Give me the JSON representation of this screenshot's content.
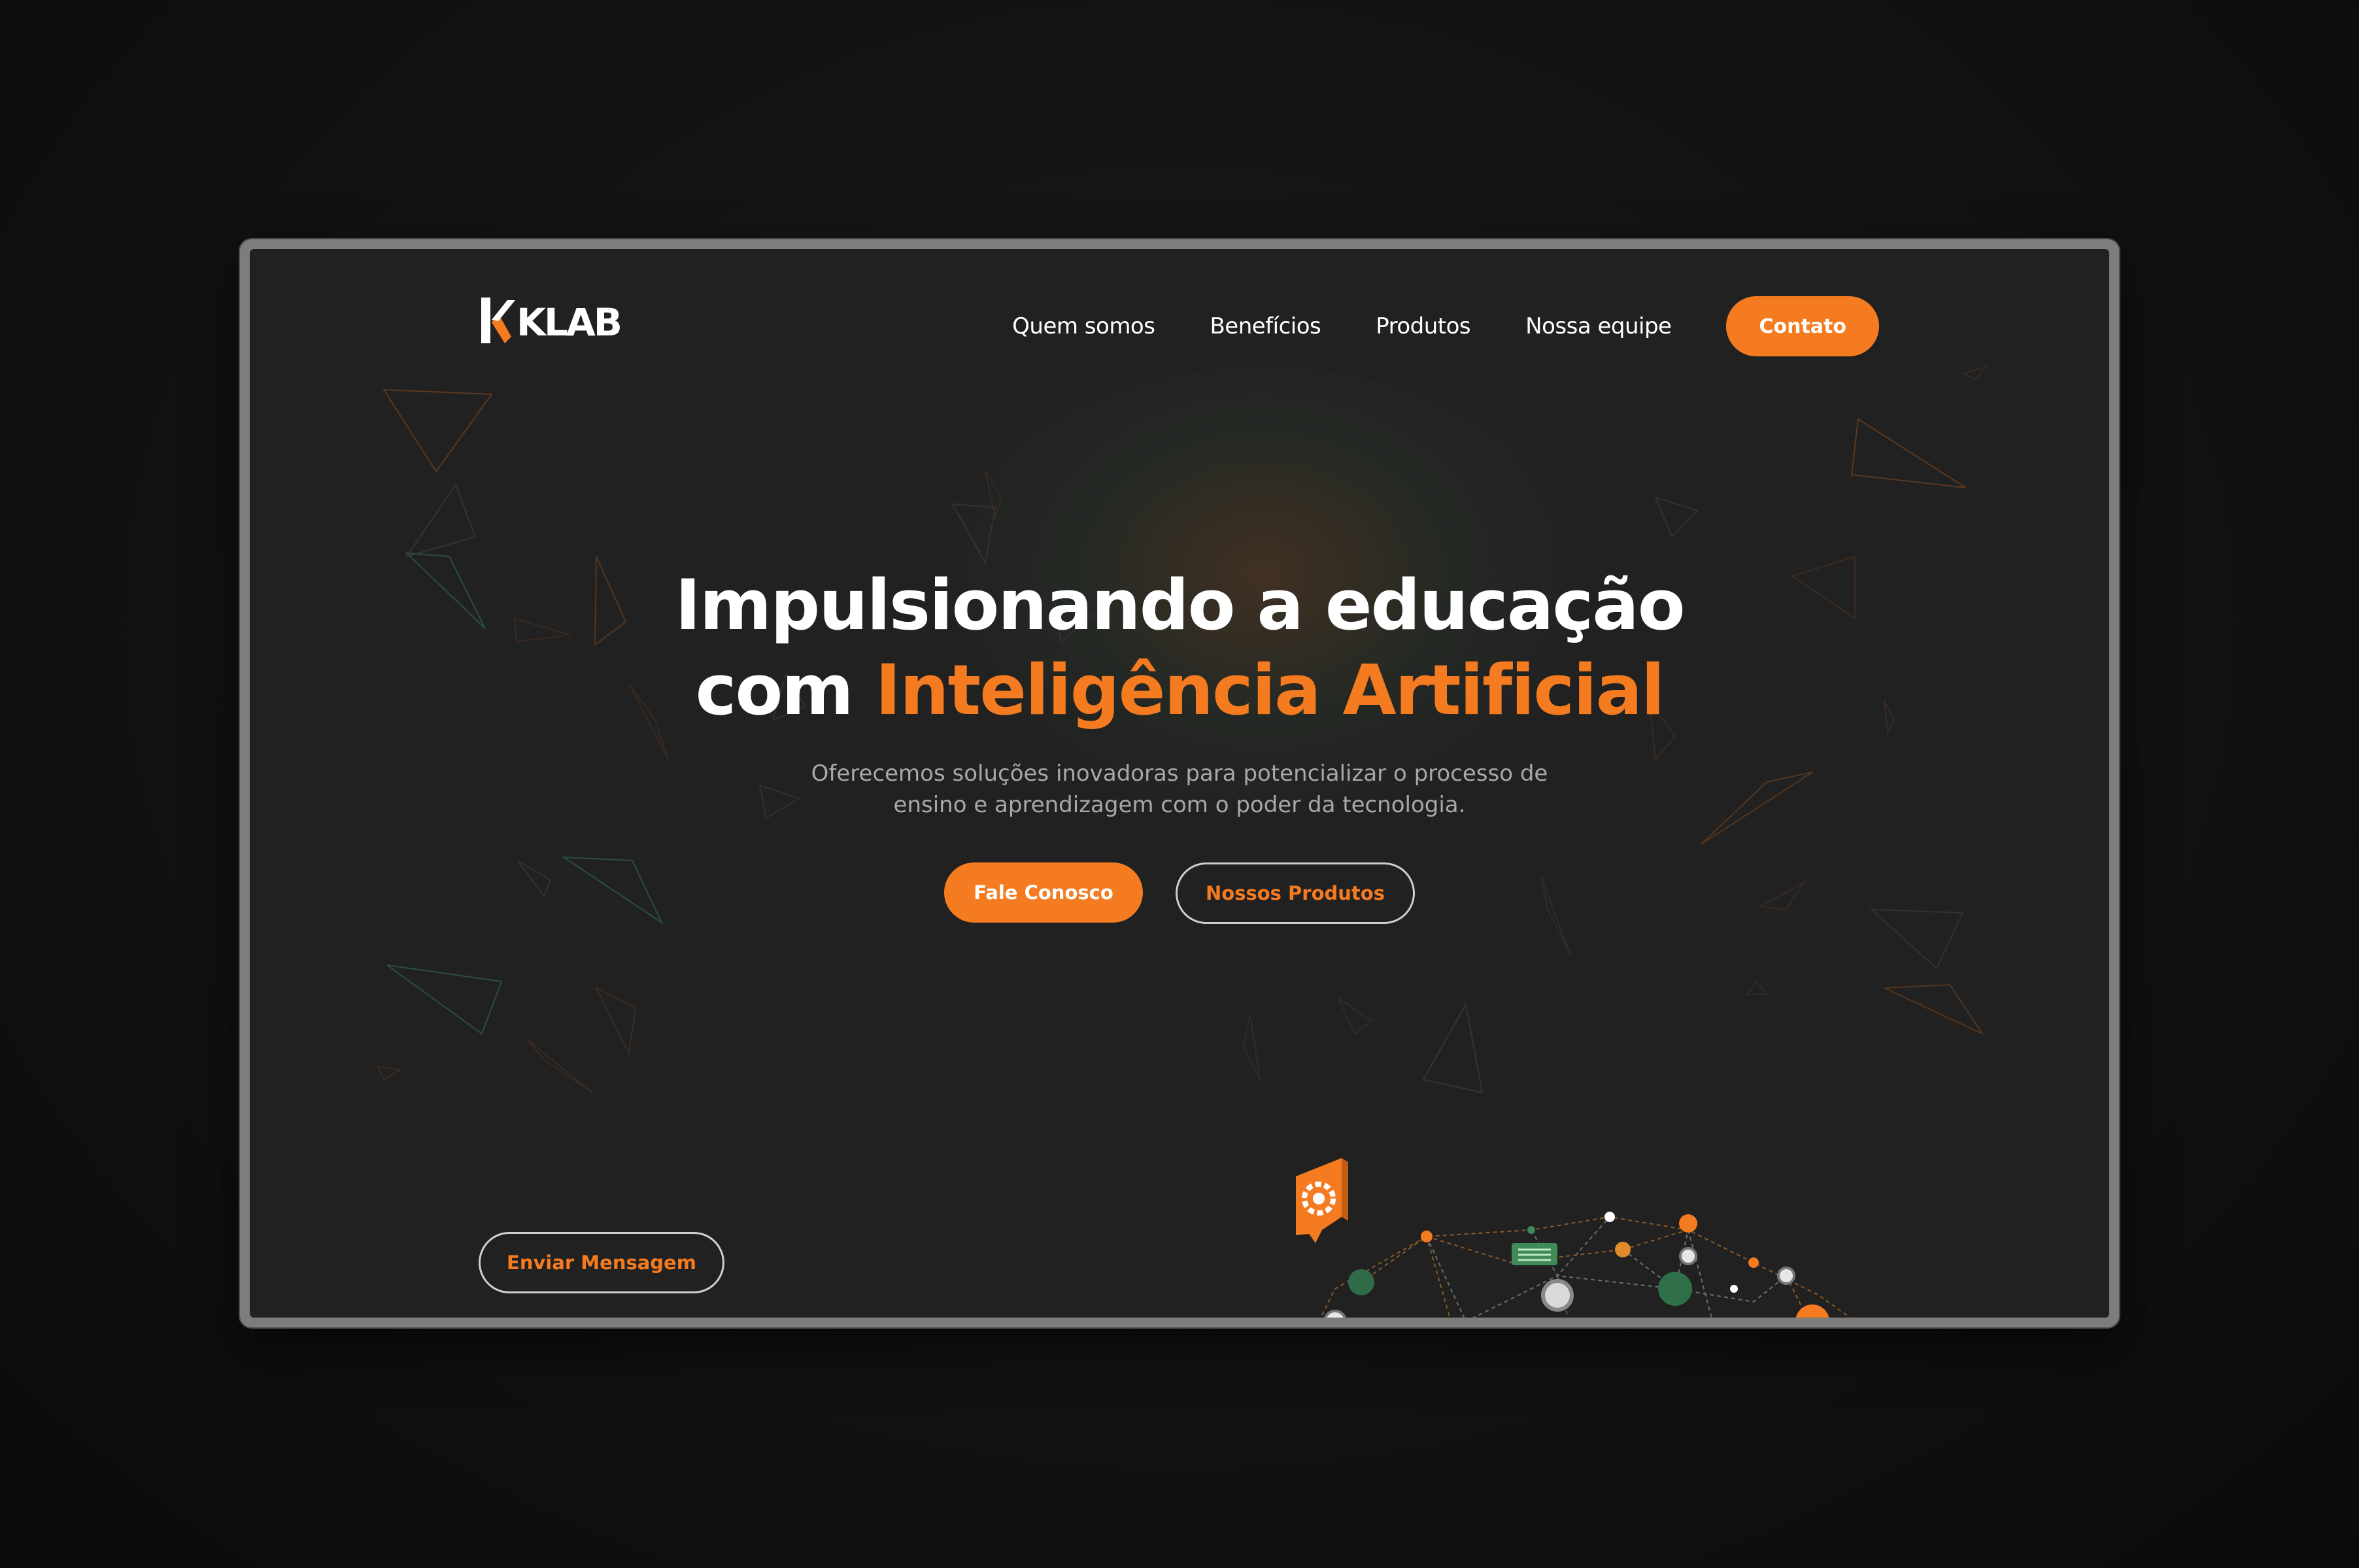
{
  "brand": {
    "logo_text": "KLAB",
    "accent_color": "#f47b20",
    "background_color": "#212121"
  },
  "nav": {
    "items": [
      {
        "label": "Quem somos"
      },
      {
        "label": "Benefícios"
      },
      {
        "label": "Produtos"
      },
      {
        "label": "Nossa equipe"
      }
    ],
    "cta_label": "Contato"
  },
  "hero": {
    "title_line1": "Impulsionando a educação",
    "title_line2_prefix": "com ",
    "title_line2_accent": "Inteligência Artificial",
    "subtitle": "Oferecemos soluções inovadoras para potencializar o processo de ensino e aprendizagem com o poder da tecnologia.",
    "primary_button": "Fale Conosco",
    "secondary_button": "Nossos Produtos"
  },
  "footer_action": {
    "send_button": "Enviar Mensagem"
  },
  "icons": {
    "gear_badge": "gear-icon",
    "network_graphic": "network-illustration"
  }
}
